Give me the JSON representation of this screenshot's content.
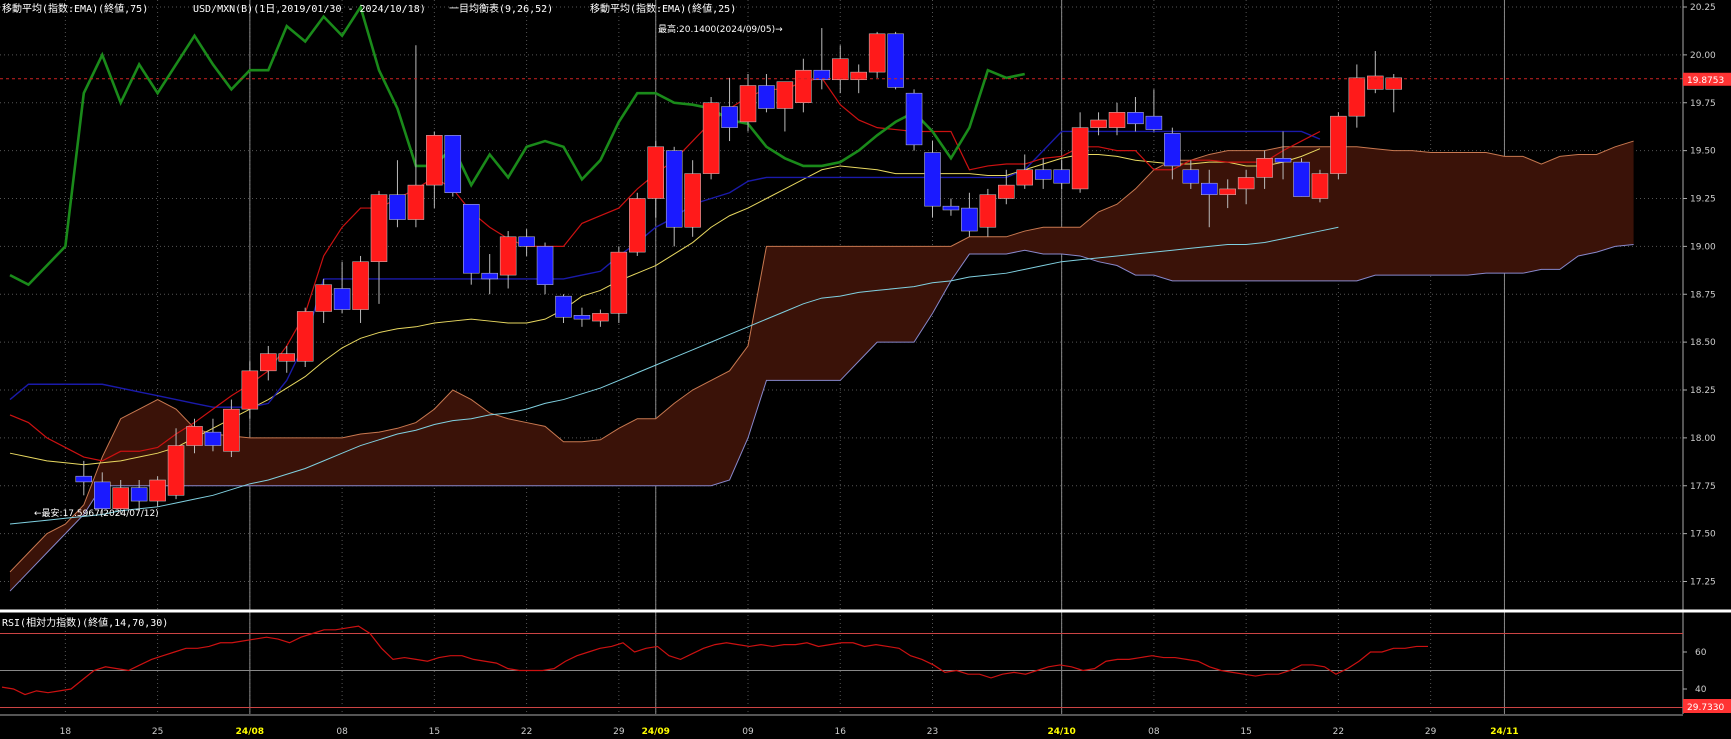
{
  "header": {
    "ema75_label": "移動平均(指数:EMA)(終値,75)",
    "symbol_label": "USD/MXN(B)(1日,2019/01/30 - 2024/10/18)",
    "ichimoku_label": "一目均衡表(9,26,52)",
    "ema25_label": "移動平均(指数:EMA)(終値,25)"
  },
  "annotations": {
    "high": "最高:20.1400(2024/09/05)→",
    "low": "←最安:17.5967(2024/07/12)"
  },
  "price_tag": {
    "text": "19.8753",
    "value": 19.8753,
    "color": "#ff3333"
  },
  "rsi_header": "RSI(相対力指数)(終値,14,70,30)",
  "rsi_tag": {
    "text": "29.7330",
    "color": "#ff3333"
  },
  "colors": {
    "up": "#ff1a1a",
    "down": "#1a1aff",
    "cloud": "#3a1208",
    "cloud_edge_a": "#c87850",
    "cloud_edge_b": "#8888cc",
    "ema25": "#e8d860",
    "ema75": "#80d0e0",
    "tenkan": "#cc1111",
    "kijun": "#1a1aaa",
    "chikou": "#1a8a1a",
    "rsi": "#cc1111",
    "grid": "#555555",
    "highline": "#cc2222"
  },
  "chart_data": [
    {
      "type": "candlestick",
      "y_ticks": [
        "20.25",
        "20.00",
        "19.75",
        "19.50",
        "19.25",
        "19.00",
        "18.75",
        "18.50",
        "18.25",
        "18.00",
        "17.75",
        "17.50",
        "17.25"
      ],
      "ylim": [
        17.1,
        20.3
      ],
      "x_labels": [
        {
          "i": 3,
          "text": "18"
        },
        {
          "i": 8,
          "text": "25"
        },
        {
          "i": 13,
          "text": "24/08",
          "major": true
        },
        {
          "i": 18,
          "text": "08"
        },
        {
          "i": 23,
          "text": "15"
        },
        {
          "i": 28,
          "text": "22"
        },
        {
          "i": 33,
          "text": "29"
        },
        {
          "i": 35,
          "text": "24/09",
          "major": true
        },
        {
          "i": 40,
          "text": "09"
        },
        {
          "i": 45,
          "text": "16"
        },
        {
          "i": 50,
          "text": "23"
        },
        {
          "i": 57,
          "text": "24/10",
          "major": true
        },
        {
          "i": 62,
          "text": "08"
        },
        {
          "i": 67,
          "text": "15"
        },
        {
          "i": 72,
          "text": "22"
        },
        {
          "i": 77,
          "text": "29"
        },
        {
          "i": 81,
          "text": "24/11",
          "major": true
        }
      ],
      "vlines": [
        13,
        35,
        57,
        81
      ],
      "candles": [
        {
          "o": 17.8,
          "h": 17.88,
          "l": 17.7,
          "c": 17.77
        },
        {
          "o": 17.77,
          "h": 17.82,
          "l": 17.6,
          "c": 17.63
        },
        {
          "o": 17.63,
          "h": 17.78,
          "l": 17.6,
          "c": 17.74
        },
        {
          "o": 17.74,
          "h": 17.78,
          "l": 17.62,
          "c": 17.67
        },
        {
          "o": 17.67,
          "h": 17.8,
          "l": 17.64,
          "c": 17.78
        },
        {
          "o": 17.7,
          "h": 18.05,
          "l": 17.68,
          "c": 17.96
        },
        {
          "o": 17.96,
          "h": 18.1,
          "l": 17.92,
          "c": 18.06
        },
        {
          "o": 18.03,
          "h": 18.1,
          "l": 17.93,
          "c": 17.96
        },
        {
          "o": 17.93,
          "h": 18.2,
          "l": 17.9,
          "c": 18.15
        },
        {
          "o": 18.15,
          "h": 18.4,
          "l": 18.1,
          "c": 18.35
        },
        {
          "o": 18.35,
          "h": 18.48,
          "l": 18.3,
          "c": 18.44
        },
        {
          "o": 18.4,
          "h": 18.48,
          "l": 18.34,
          "c": 18.44
        },
        {
          "o": 18.4,
          "h": 18.68,
          "l": 18.37,
          "c": 18.66
        },
        {
          "o": 18.66,
          "h": 18.83,
          "l": 18.6,
          "c": 18.8
        },
        {
          "o": 18.78,
          "h": 18.92,
          "l": 18.65,
          "c": 18.67
        },
        {
          "o": 18.67,
          "h": 18.95,
          "l": 18.6,
          "c": 18.92
        },
        {
          "o": 18.92,
          "h": 19.29,
          "l": 18.7,
          "c": 19.27
        },
        {
          "o": 19.27,
          "h": 19.45,
          "l": 19.1,
          "c": 19.14
        },
        {
          "o": 19.14,
          "h": 20.05,
          "l": 19.1,
          "c": 19.32
        },
        {
          "o": 19.32,
          "h": 19.6,
          "l": 19.2,
          "c": 19.58
        },
        {
          "o": 19.58,
          "h": 19.58,
          "l": 19.26,
          "c": 19.28
        },
        {
          "o": 19.22,
          "h": 19.22,
          "l": 18.8,
          "c": 18.86
        },
        {
          "o": 18.86,
          "h": 18.96,
          "l": 18.75,
          "c": 18.83
        },
        {
          "o": 18.85,
          "h": 19.08,
          "l": 18.78,
          "c": 19.05
        },
        {
          "o": 19.05,
          "h": 19.09,
          "l": 18.95,
          "c": 19.0
        },
        {
          "o": 19.0,
          "h": 19.02,
          "l": 18.75,
          "c": 18.8
        },
        {
          "o": 18.74,
          "h": 18.75,
          "l": 18.6,
          "c": 18.63
        },
        {
          "o": 18.64,
          "h": 18.68,
          "l": 18.58,
          "c": 18.62
        },
        {
          "o": 18.61,
          "h": 18.67,
          "l": 18.58,
          "c": 18.65
        },
        {
          "o": 18.65,
          "h": 19.0,
          "l": 18.6,
          "c": 18.97
        },
        {
          "o": 18.97,
          "h": 19.28,
          "l": 18.95,
          "c": 19.25
        },
        {
          "o": 19.25,
          "h": 19.55,
          "l": 19.15,
          "c": 19.52
        },
        {
          "o": 19.5,
          "h": 19.52,
          "l": 19.0,
          "c": 19.1
        },
        {
          "o": 19.1,
          "h": 19.45,
          "l": 19.05,
          "c": 19.38
        },
        {
          "o": 19.38,
          "h": 19.78,
          "l": 19.35,
          "c": 19.75
        },
        {
          "o": 19.73,
          "h": 19.88,
          "l": 19.55,
          "c": 19.62
        },
        {
          "o": 19.65,
          "h": 19.9,
          "l": 19.6,
          "c": 19.84
        },
        {
          "o": 19.84,
          "h": 19.9,
          "l": 19.7,
          "c": 19.72
        },
        {
          "o": 19.72,
          "h": 19.86,
          "l": 19.6,
          "c": 19.86
        },
        {
          "o": 19.75,
          "h": 19.98,
          "l": 19.7,
          "c": 19.92
        },
        {
          "o": 19.92,
          "h": 20.14,
          "l": 19.82,
          "c": 19.87
        },
        {
          "o": 19.87,
          "h": 20.05,
          "l": 19.8,
          "c": 19.98
        },
        {
          "o": 19.87,
          "h": 19.95,
          "l": 19.8,
          "c": 19.91
        },
        {
          "o": 19.91,
          "h": 20.12,
          "l": 19.88,
          "c": 20.11
        },
        {
          "o": 20.11,
          "h": 20.12,
          "l": 19.82,
          "c": 19.83
        },
        {
          "o": 19.8,
          "h": 19.82,
          "l": 19.5,
          "c": 19.53
        },
        {
          "o": 19.49,
          "h": 19.55,
          "l": 19.15,
          "c": 19.21
        },
        {
          "o": 19.21,
          "h": 19.25,
          "l": 19.16,
          "c": 19.19
        },
        {
          "o": 19.2,
          "h": 19.28,
          "l": 19.05,
          "c": 19.08
        },
        {
          "o": 19.1,
          "h": 19.3,
          "l": 19.05,
          "c": 19.27
        },
        {
          "o": 19.25,
          "h": 19.4,
          "l": 19.22,
          "c": 19.32
        },
        {
          "o": 19.32,
          "h": 19.48,
          "l": 19.3,
          "c": 19.4
        },
        {
          "o": 19.4,
          "h": 19.46,
          "l": 19.3,
          "c": 19.35
        },
        {
          "o": 19.4,
          "h": 19.45,
          "l": 19.3,
          "c": 19.33
        },
        {
          "o": 19.3,
          "h": 19.7,
          "l": 19.28,
          "c": 19.62
        },
        {
          "o": 19.62,
          "h": 19.7,
          "l": 19.58,
          "c": 19.66
        },
        {
          "o": 19.62,
          "h": 19.75,
          "l": 19.58,
          "c": 19.7
        },
        {
          "o": 19.7,
          "h": 19.78,
          "l": 19.6,
          "c": 19.64
        },
        {
          "o": 19.68,
          "h": 19.82,
          "l": 19.6,
          "c": 19.61
        },
        {
          "o": 19.59,
          "h": 19.62,
          "l": 19.35,
          "c": 19.42
        },
        {
          "o": 19.4,
          "h": 19.45,
          "l": 19.3,
          "c": 19.33
        },
        {
          "o": 19.33,
          "h": 19.4,
          "l": 19.1,
          "c": 19.27
        },
        {
          "o": 19.27,
          "h": 19.35,
          "l": 19.2,
          "c": 19.3
        },
        {
          "o": 19.3,
          "h": 19.4,
          "l": 19.22,
          "c": 19.36
        },
        {
          "o": 19.36,
          "h": 19.5,
          "l": 19.3,
          "c": 19.46
        },
        {
          "o": 19.46,
          "h": 19.6,
          "l": 19.35,
          "c": 19.44
        },
        {
          "o": 19.44,
          "h": 19.46,
          "l": 19.26,
          "c": 19.26
        },
        {
          "o": 19.25,
          "h": 19.4,
          "l": 19.23,
          "c": 19.38
        },
        {
          "o": 19.38,
          "h": 19.7,
          "l": 19.35,
          "c": 19.68
        },
        {
          "o": 19.68,
          "h": 19.95,
          "l": 19.62,
          "c": 19.88
        },
        {
          "o": 19.82,
          "h": 20.02,
          "l": 19.8,
          "c": 19.89
        },
        {
          "o": 19.82,
          "h": 19.9,
          "l": 19.7,
          "c": 19.88
        }
      ],
      "price_offset": 4,
      "cloud_a": [
        17.3,
        17.4,
        17.5,
        17.55,
        17.65,
        17.9,
        18.1,
        18.15,
        18.2,
        18.15,
        18.05,
        18.02,
        18.01,
        18.0,
        18.0,
        18.0,
        18.0,
        18.0,
        18.0,
        18.02,
        18.03,
        18.05,
        18.08,
        18.15,
        18.25,
        18.2,
        18.13,
        18.1,
        18.08,
        18.06,
        17.98,
        17.98,
        17.99,
        18.05,
        18.1,
        18.1,
        18.18,
        18.25,
        18.3,
        18.35,
        18.48,
        19.0,
        19.0,
        19.0,
        19.0,
        19.0,
        19.0,
        19.0,
        19.0,
        19.0,
        19.0,
        19.0,
        19.05,
        19.05,
        19.05,
        19.08,
        19.1,
        19.1,
        19.1,
        19.18,
        19.22,
        19.3,
        19.4,
        19.45,
        19.45,
        19.48,
        19.5,
        19.5,
        19.5,
        19.52,
        19.52,
        19.52,
        19.52,
        19.52,
        19.51,
        19.5,
        19.5,
        19.49,
        19.49,
        19.49,
        19.49,
        19.47,
        19.47,
        19.43,
        19.47,
        19.48,
        19.48,
        19.52,
        19.55
      ],
      "cloud_b": [
        17.2,
        17.3,
        17.4,
        17.5,
        17.6,
        17.75,
        17.75,
        17.75,
        17.75,
        17.75,
        17.75,
        17.75,
        17.75,
        17.75,
        17.75,
        17.75,
        17.75,
        17.75,
        17.75,
        17.75,
        17.75,
        17.75,
        17.75,
        17.75,
        17.75,
        17.75,
        17.75,
        17.75,
        17.75,
        17.75,
        17.75,
        17.75,
        17.75,
        17.75,
        17.75,
        17.75,
        17.75,
        17.75,
        17.75,
        17.78,
        18.0,
        18.3,
        18.3,
        18.3,
        18.3,
        18.3,
        18.4,
        18.5,
        18.5,
        18.5,
        18.65,
        18.82,
        18.96,
        18.96,
        18.96,
        18.98,
        18.96,
        18.96,
        18.95,
        18.92,
        18.9,
        18.85,
        18.85,
        18.82,
        18.82,
        18.82,
        18.82,
        18.82,
        18.82,
        18.82,
        18.82,
        18.82,
        18.82,
        18.82,
        18.85,
        18.85,
        18.85,
        18.85,
        18.85,
        18.85,
        18.86,
        18.86,
        18.86,
        18.88,
        18.88,
        18.95,
        18.97,
        19.0,
        19.01
      ],
      "ema25": [
        17.92,
        17.9,
        17.88,
        17.87,
        17.86,
        17.87,
        17.88,
        17.9,
        17.92,
        17.95,
        18.0,
        18.05,
        18.1,
        18.15,
        18.2,
        18.26,
        18.32,
        18.4,
        18.47,
        18.52,
        18.55,
        18.57,
        18.58,
        18.6,
        18.61,
        18.62,
        18.61,
        18.6,
        18.6,
        18.62,
        18.67,
        18.74,
        18.77,
        18.82,
        18.86,
        18.9,
        18.96,
        19.02,
        19.1,
        19.16,
        19.2,
        19.25,
        19.3,
        19.35,
        19.4,
        19.42,
        19.41,
        19.4,
        19.38,
        19.38,
        19.38,
        19.38,
        19.38,
        19.37,
        19.37,
        19.4,
        19.43,
        19.46,
        19.48,
        19.48,
        19.47,
        19.45,
        19.44,
        19.43,
        19.43,
        19.44,
        19.44,
        19.42,
        19.42,
        19.44,
        19.47,
        19.51
      ],
      "ema75": [
        17.55,
        17.56,
        17.57,
        17.58,
        17.59,
        17.6,
        17.62,
        17.63,
        17.64,
        17.66,
        17.68,
        17.7,
        17.73,
        17.76,
        17.78,
        17.81,
        17.84,
        17.88,
        17.92,
        17.96,
        17.99,
        18.02,
        18.04,
        18.07,
        18.09,
        18.1,
        18.12,
        18.13,
        18.15,
        18.18,
        18.2,
        18.23,
        18.26,
        18.3,
        18.34,
        18.38,
        18.42,
        18.46,
        18.5,
        18.54,
        18.58,
        18.62,
        18.66,
        18.7,
        18.73,
        18.74,
        18.76,
        18.77,
        18.78,
        18.79,
        18.81,
        18.82,
        18.84,
        18.85,
        18.86,
        18.88,
        18.9,
        18.92,
        18.93,
        18.94,
        18.95,
        18.96,
        18.97,
        18.98,
        18.99,
        19.0,
        19.01,
        19.01,
        19.02,
        19.04,
        19.06,
        19.08,
        19.1
      ],
      "tenkan": [
        18.12,
        18.08,
        18.0,
        17.95,
        17.9,
        17.88,
        17.93,
        17.93,
        17.95,
        18.02,
        18.08,
        18.15,
        18.22,
        18.28,
        18.35,
        18.48,
        18.65,
        18.95,
        19.1,
        19.2,
        19.2,
        19.25,
        19.3,
        19.36,
        19.3,
        19.18,
        19.1,
        19.04,
        19.0,
        19.0,
        19.0,
        19.12,
        19.16,
        19.2,
        19.3,
        19.38,
        19.45,
        19.55,
        19.65,
        19.72,
        19.78,
        19.82,
        19.82,
        19.86,
        19.88,
        19.74,
        19.66,
        19.62,
        19.61,
        19.6,
        19.6,
        19.6,
        19.4,
        19.42,
        19.43,
        19.43,
        19.46,
        19.47,
        19.52,
        19.52,
        19.5,
        19.5,
        19.4,
        19.4,
        19.45,
        19.45,
        19.44,
        19.44,
        19.44,
        19.5,
        19.55,
        19.6
      ],
      "kijun": [
        18.2,
        18.28,
        18.28,
        18.28,
        18.28,
        18.28,
        18.26,
        18.24,
        18.22,
        18.2,
        18.18,
        18.16,
        18.16,
        18.16,
        18.18,
        18.3,
        18.5,
        18.83,
        18.83,
        18.83,
        18.83,
        18.83,
        18.83,
        18.83,
        18.83,
        18.83,
        18.83,
        18.83,
        18.83,
        18.83,
        18.83,
        18.85,
        18.87,
        18.95,
        19.02,
        19.1,
        19.15,
        19.22,
        19.25,
        19.28,
        19.34,
        19.36,
        19.36,
        19.36,
        19.36,
        19.36,
        19.36,
        19.36,
        19.36,
        19.36,
        19.36,
        19.36,
        19.36,
        19.36,
        19.36,
        19.4,
        19.5,
        19.6,
        19.6,
        19.6,
        19.6,
        19.6,
        19.6,
        19.6,
        19.6,
        19.6,
        19.6,
        19.6,
        19.6,
        19.6,
        19.6,
        19.56
      ],
      "chikou": [
        18.85,
        18.8,
        18.9,
        19.0,
        19.8,
        20.0,
        19.75,
        19.95,
        19.8,
        19.95,
        20.1,
        19.95,
        19.82,
        19.92,
        19.92,
        20.15,
        20.07,
        20.2,
        20.1,
        20.25,
        19.92,
        19.72,
        19.42,
        19.42,
        19.52,
        19.32,
        19.48,
        19.36,
        19.52,
        19.55,
        19.52,
        19.35,
        19.45,
        19.65,
        19.8,
        19.8,
        19.75,
        19.74,
        19.72,
        19.66,
        19.64,
        19.52,
        19.46,
        19.42,
        19.42,
        19.44,
        19.5,
        19.58,
        19.65,
        19.7,
        19.6,
        19.46,
        19.62,
        19.92,
        19.88,
        19.9
      ]
    },
    {
      "type": "line",
      "name": "",
      "y_ticks": [
        "60",
        "40"
      ],
      "ylim": [
        30,
        78
      ],
      "bands": [
        70,
        50,
        30
      ],
      "values": [
        41,
        40,
        37,
        39,
        38,
        39,
        40,
        45,
        50,
        52,
        51,
        50,
        53,
        56,
        58,
        60,
        62,
        62,
        63,
        65,
        65,
        66,
        67,
        68,
        67,
        65,
        68,
        70,
        72,
        72,
        73,
        74,
        70,
        62,
        56,
        57,
        56,
        55,
        57,
        58,
        58,
        56,
        55,
        54,
        51,
        50,
        50,
        50,
        51,
        55,
        58,
        60,
        62,
        63,
        65,
        60,
        62,
        63,
        58,
        56,
        59,
        62,
        64,
        65,
        64,
        63,
        64,
        63,
        64,
        64,
        65,
        63,
        64,
        65,
        65,
        63,
        64,
        63,
        62,
        58,
        56,
        53,
        49,
        50,
        48,
        48,
        46,
        48,
        49,
        48,
        50,
        52,
        53,
        52,
        50,
        51,
        55,
        56,
        56,
        57,
        58,
        57,
        57,
        56,
        55,
        52,
        50,
        49,
        48,
        47,
        48,
        48,
        50,
        53,
        53,
        52,
        48,
        51,
        55,
        60,
        60,
        62,
        62,
        63,
        63
      ]
    }
  ]
}
